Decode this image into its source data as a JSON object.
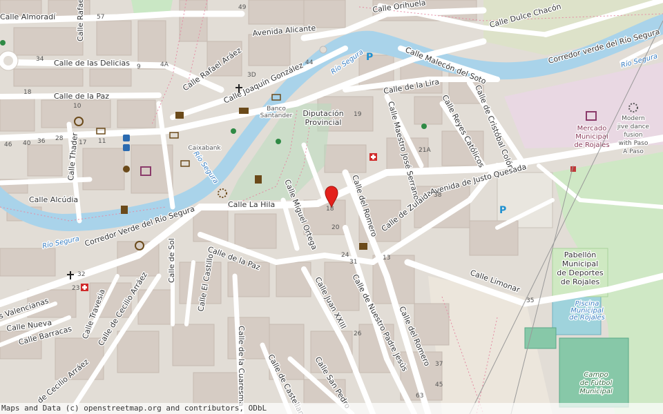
{
  "map": {
    "attribution": "Maps and Data (c) openstreetmap.org and contributors, ODbL",
    "colors": {
      "water": "#a9d3ea",
      "building": "#d9d0c9",
      "road": "#ffffff",
      "park": "#c9e7c4",
      "pitch": "#87c8a8",
      "marker": "#e4211c"
    },
    "streets": [
      {
        "id": "almoradi",
        "text": "Calle Almoradí"
      },
      {
        "id": "rafael-alb",
        "text": "Calle Rafael Albe"
      },
      {
        "id": "delicias",
        "text": "Calle de las Delicias"
      },
      {
        "id": "paz1",
        "text": "Calle de la Paz"
      },
      {
        "id": "rafael-araez",
        "text": "Calle Rafael Aráez"
      },
      {
        "id": "joaquin",
        "text": "Calle Joaquín González"
      },
      {
        "id": "alicante",
        "text": "Avenida Alicante"
      },
      {
        "id": "orihuela",
        "text": "Calle Orihuela"
      },
      {
        "id": "chacon",
        "text": "Calle Dulce Chacón"
      },
      {
        "id": "verde1",
        "text": "Corredor verde del Río Segura"
      },
      {
        "id": "malecon",
        "text": "Calle Malecón del Soto"
      },
      {
        "id": "lira",
        "text": "Calle de la Lira"
      },
      {
        "id": "cristobal",
        "text": "Calle de Cristóbal Colón"
      },
      {
        "id": "reyes",
        "text": "Calle Reyes Católicos"
      },
      {
        "id": "maestro",
        "text": "Calle Maestro José Serrano"
      },
      {
        "id": "thader",
        "text": "Calle Thader"
      },
      {
        "id": "alcudia",
        "text": "Calle Alcúdia"
      },
      {
        "id": "verde2",
        "text": "Corredor Verde del Río Segura"
      },
      {
        "id": "hila",
        "text": "Calle La Hila"
      },
      {
        "id": "miguel",
        "text": "Calle Miguel Ortega"
      },
      {
        "id": "romero1",
        "text": "Calle del Romero"
      },
      {
        "id": "zulaida",
        "text": "Calle de Zulaida"
      },
      {
        "id": "justo",
        "text": "Avenida de Justo Quesada"
      },
      {
        "id": "paz2",
        "text": "Calle de la Paz"
      },
      {
        "id": "sol",
        "text": "Calle de Sol"
      },
      {
        "id": "castillo",
        "text": "Calle El Castillo"
      },
      {
        "id": "juan",
        "text": "Calle Juan XXIII"
      },
      {
        "id": "nuestro",
        "text": "Calle de Nuestro Padre Jesús"
      },
      {
        "id": "romero2",
        "text": "Calle del Romero"
      },
      {
        "id": "limonar",
        "text": "Calle Limonar"
      },
      {
        "id": "valencianas",
        "text": "s Valencianas"
      },
      {
        "id": "nueva",
        "text": "Calle Nueva"
      },
      {
        "id": "barracas",
        "text": "Calle Barracas"
      },
      {
        "id": "travesia",
        "text": "Calle Travesia"
      },
      {
        "id": "cecilio1",
        "text": "Calle de Cecilio Arráez"
      },
      {
        "id": "cecilio2",
        "text": "de Cecilio Arráez"
      },
      {
        "id": "cuaresma",
        "text": "Calle de la Cuaresma"
      },
      {
        "id": "castellana",
        "text": "Calle de Castellana"
      },
      {
        "id": "sanpedro",
        "text": "Calle San Pedro"
      }
    ],
    "water_labels": [
      {
        "id": "rio1",
        "text": "Río Segura"
      },
      {
        "id": "rio2",
        "text": "Río Segura"
      },
      {
        "id": "rio3",
        "text": "Río Segura"
      },
      {
        "id": "rio4",
        "text": "Río Segura"
      }
    ],
    "pois": [
      {
        "id": "diputacion",
        "lines": [
          "Diputación",
          "Provincial"
        ]
      },
      {
        "id": "banco",
        "lines": [
          "Banco",
          "Santander"
        ]
      },
      {
        "id": "caixa",
        "lines": [
          "Caixabank"
        ]
      },
      {
        "id": "mercado",
        "lines": [
          "Mercado",
          "Municipal",
          "de Rojales"
        ]
      },
      {
        "id": "jive",
        "lines": [
          "Modern",
          "jive dance",
          "fusion",
          "with Paso",
          "A Paso"
        ]
      },
      {
        "id": "pabellon",
        "lines": [
          "Pabellón",
          "Municipal",
          "de Deportes",
          "de Rojales"
        ]
      },
      {
        "id": "piscina",
        "lines": [
          "Piscina",
          "Municipal",
          "de Rojales"
        ]
      },
      {
        "id": "campo",
        "lines": [
          "Campo",
          "de Fútbol",
          "Municipal"
        ]
      }
    ],
    "house_numbers": [
      {
        "id": "h57",
        "text": "57"
      },
      {
        "id": "h49",
        "text": "49"
      },
      {
        "id": "h34",
        "text": "34"
      },
      {
        "id": "h9a",
        "text": "9"
      },
      {
        "id": "h4a",
        "text": "4A"
      },
      {
        "id": "h18a",
        "text": "18"
      },
      {
        "id": "h10",
        "text": "10"
      },
      {
        "id": "h28",
        "text": "28"
      },
      {
        "id": "h46",
        "text": "46"
      },
      {
        "id": "h40",
        "text": "40"
      },
      {
        "id": "h36",
        "text": "36"
      },
      {
        "id": "h17",
        "text": "17"
      },
      {
        "id": "h11",
        "text": "11"
      },
      {
        "id": "h32",
        "text": "32"
      },
      {
        "id": "h23",
        "text": "23"
      },
      {
        "id": "h19",
        "text": "19"
      },
      {
        "id": "h21a",
        "text": "21A"
      },
      {
        "id": "h38",
        "text": "38"
      },
      {
        "id": "h20",
        "text": "20"
      },
      {
        "id": "h24",
        "text": "24"
      },
      {
        "id": "h31",
        "text": "31"
      },
      {
        "id": "h13",
        "text": "13"
      },
      {
        "id": "h35",
        "text": "35"
      },
      {
        "id": "h26",
        "text": "26"
      },
      {
        "id": "h37",
        "text": "37"
      },
      {
        "id": "h45",
        "text": "45"
      },
      {
        "id": "h63",
        "text": "63"
      },
      {
        "id": "h18b",
        "text": "18"
      },
      {
        "id": "h44",
        "text": "44"
      },
      {
        "id": "h3d",
        "text": "3D"
      }
    ]
  }
}
